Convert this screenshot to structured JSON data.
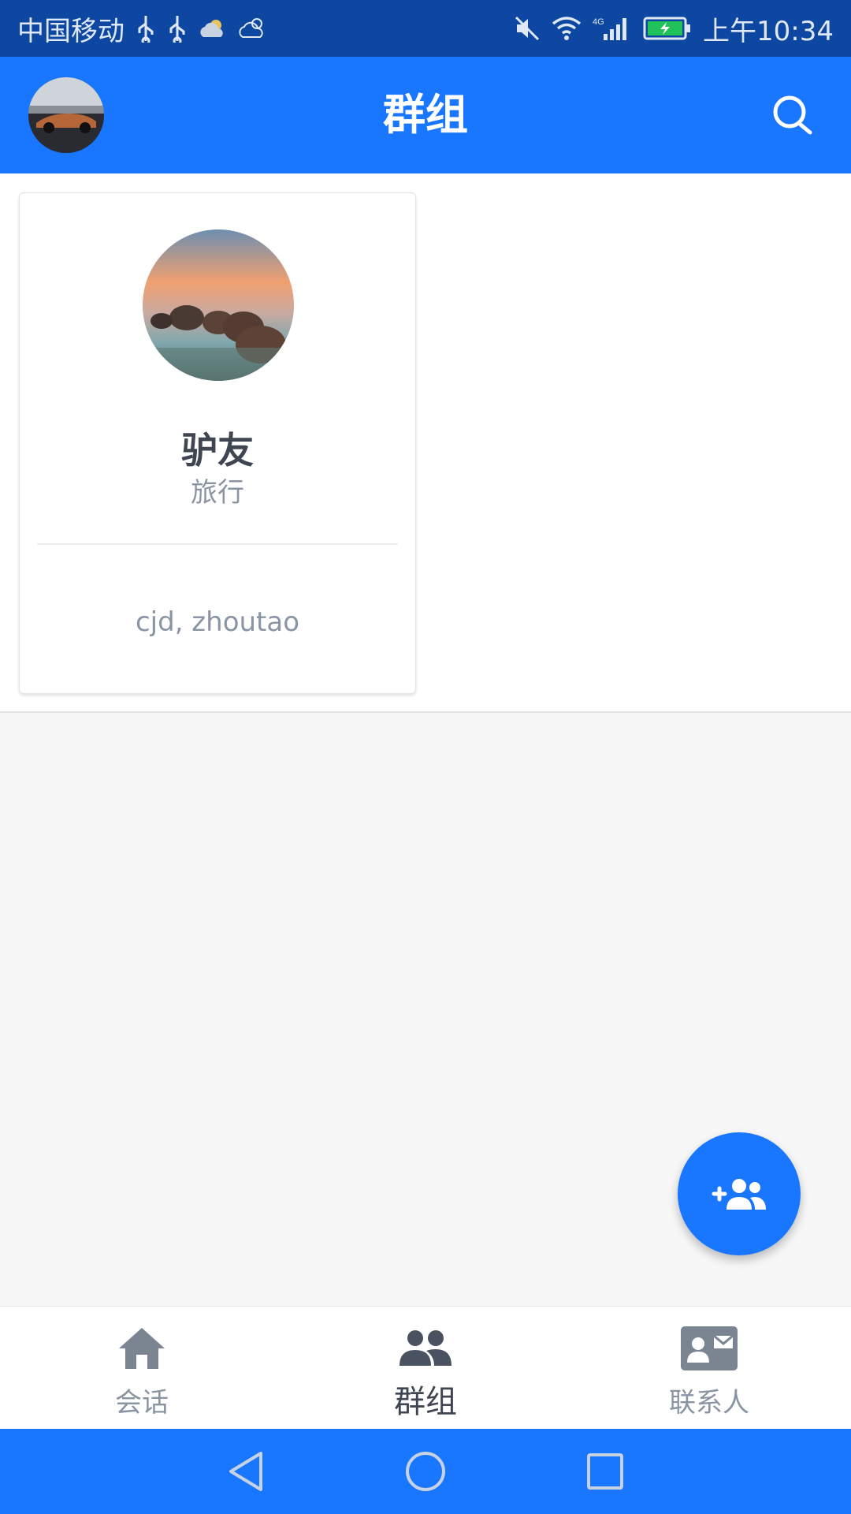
{
  "status_bar": {
    "carrier": "中国移动",
    "network": "4G",
    "time": "上午10:34"
  },
  "app_bar": {
    "title": "群组"
  },
  "groups": [
    {
      "name": "驴友",
      "category": "旅行",
      "members": "cjd, zhoutao"
    }
  ],
  "bottom_nav": {
    "items": [
      {
        "label": "会话",
        "icon": "home-icon",
        "active": false
      },
      {
        "label": "群组",
        "icon": "group-icon",
        "active": true
      },
      {
        "label": "联系人",
        "icon": "contact-card-icon",
        "active": false
      }
    ]
  },
  "fab": {
    "icon": "add-group-icon"
  },
  "colors": {
    "primary": "#1976ff",
    "status_bar": "#0d47a1",
    "text_dark": "#3f4652",
    "text_muted": "#8a94a3"
  }
}
